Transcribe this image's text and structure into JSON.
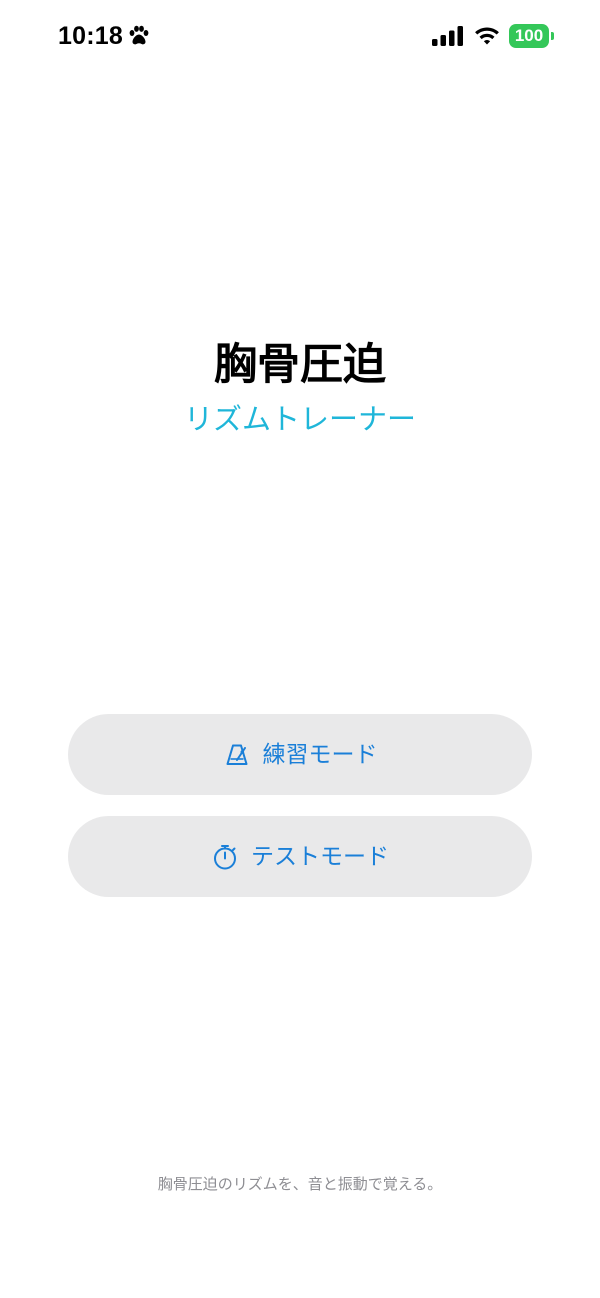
{
  "status_bar": {
    "time": "10:18",
    "battery_level": "100",
    "icons": [
      "paw-icon",
      "cellular-signal-icon",
      "wifi-icon",
      "battery-icon"
    ],
    "battery_color": "#34c759"
  },
  "header": {
    "title": "胸骨圧迫",
    "subtitle": "リズムトレーナー",
    "subtitle_color": "#1fb6d9"
  },
  "buttons": {
    "practice": {
      "label": "練習モード",
      "icon": "metronome-icon"
    },
    "test": {
      "label": "テストモード",
      "icon": "stopwatch-icon"
    },
    "accent_color": "#1a7fd8",
    "background_color": "#e9e9ea"
  },
  "footer": {
    "text": "胸骨圧迫のリズムを、音と振動で覚える。"
  }
}
